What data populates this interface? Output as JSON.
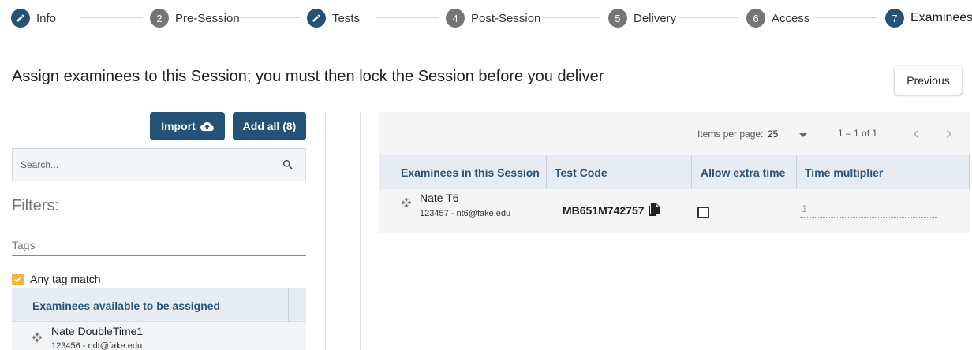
{
  "stepper": {
    "steps": [
      {
        "marker": "pencil-icon",
        "label": "Info",
        "state": "done"
      },
      {
        "marker": "2",
        "label": "Pre-Session",
        "state": "todo"
      },
      {
        "marker": "pencil-icon",
        "label": "Tests",
        "state": "done"
      },
      {
        "marker": "4",
        "label": "Post-Session",
        "state": "todo"
      },
      {
        "marker": "5",
        "label": "Delivery",
        "state": "todo"
      },
      {
        "marker": "6",
        "label": "Access",
        "state": "todo"
      },
      {
        "marker": "7",
        "label": "Examinees",
        "state": "active"
      }
    ]
  },
  "header": {
    "title": "Assign examinees to this Session; you must then lock the Session before you deliver",
    "previous_label": "Previous"
  },
  "left": {
    "import_label": "Import",
    "import_icon": "cloud-upload-icon",
    "add_all_label": "Add all (8)",
    "search": {
      "placeholder": "Search...",
      "value": ""
    },
    "filters_title": "Filters:",
    "tags_placeholder": "Tags",
    "any_tag_label": "Any tag match",
    "any_tag_checked": true,
    "available_header": "Examinees available to be assigned",
    "available": [
      {
        "name": "Nate DoubleTime1",
        "detail": "123456 - ndt@fake.edu"
      }
    ]
  },
  "right": {
    "paginator": {
      "items_per_page_label": "Items per page:",
      "items_per_page_value": "25",
      "range": "1 – 1 of 1"
    },
    "columns": [
      "Examinees in this Session",
      "Test Code",
      "Allow extra time",
      "Time multiplier"
    ],
    "rows": [
      {
        "name": "Nate T6",
        "detail": "123457 - nt6@fake.edu",
        "test_code": "MB651M742757",
        "allow_extra_time": false,
        "time_multiplier": "1"
      }
    ]
  },
  "colors": {
    "primary": "#255377",
    "header_text": "#2a5478",
    "checkbox_accent": "#f6b63e",
    "step_inactive": "#757575"
  }
}
